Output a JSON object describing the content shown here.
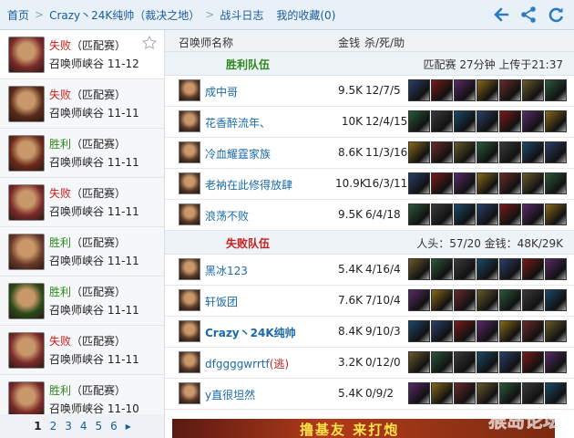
{
  "breadcrumb": [
    "首页",
    "Crazy丶24K纯帅（裁决之地）",
    "战斗日志"
  ],
  "favorites_label": "我的收藏(0)",
  "colors": {
    "win": "#2a8a1a",
    "loss": "#c81e1e",
    "link": "#1a5a9a"
  },
  "top_icons": [
    "back-arrow-icon",
    "share-icon",
    "refresh-icon"
  ],
  "matches": [
    {
      "result": "失败",
      "type": "（匹配赛）",
      "map": "召唤师峡谷",
      "date": "11-12",
      "win": false
    },
    {
      "result": "失败",
      "type": "（匹配赛）",
      "map": "召唤师峡谷",
      "date": "11-11",
      "win": false
    },
    {
      "result": "胜利",
      "type": "（匹配赛）",
      "map": "召唤师峡谷",
      "date": "11-11",
      "win": true
    },
    {
      "result": "失败",
      "type": "（匹配赛）",
      "map": "召唤师峡谷",
      "date": "11-11",
      "win": false
    },
    {
      "result": "胜利",
      "type": "（匹配赛）",
      "map": "召唤师峡谷",
      "date": "11-11",
      "win": true
    },
    {
      "result": "胜利",
      "type": "（匹配赛）",
      "map": "召唤师峡谷",
      "date": "11-11",
      "win": true
    },
    {
      "result": "失败",
      "type": "（匹配赛）",
      "map": "召唤师峡谷",
      "date": "11-11",
      "win": false
    },
    {
      "result": "胜利",
      "type": "（匹配赛）",
      "map": "召唤师峡谷",
      "date": "11-10",
      "win": true
    }
  ],
  "pager": [
    "1",
    "2",
    "3",
    "4",
    "5",
    "6",
    "▸"
  ],
  "table_header": {
    "name": "召唤师名称",
    "gold": "金钱",
    "kda": "杀/死/助"
  },
  "win_team": {
    "label": "胜利队伍",
    "info": "匹配赛 27分钟 上传于21:37",
    "players": [
      {
        "name": "成中哥",
        "gold": "9.5K",
        "kda": "12/7/5",
        "bold": false
      },
      {
        "name": "花香醉流年、",
        "gold": "10K",
        "kda": "12/4/15",
        "bold": false
      },
      {
        "name": "冷血耀霆家族",
        "gold": "8.6K",
        "kda": "11/3/16",
        "bold": false
      },
      {
        "name": "老衲在此修得放肆",
        "gold": "10.9K",
        "kda": "16/3/11",
        "bold": false
      },
      {
        "name": "浪荡不败",
        "gold": "9.5K",
        "kda": "6/4/18",
        "bold": false
      }
    ]
  },
  "lose_team": {
    "label": "失败队伍",
    "info": "人头：57/20 金钱：48K/29K",
    "players": [
      {
        "name": "黑冰123",
        "gold": "5.4K",
        "kda": "4/16/4",
        "bold": false
      },
      {
        "name": "轩饭团",
        "gold": "7.6K",
        "kda": "7/10/4",
        "bold": false
      },
      {
        "name": "Crazy丶24K纯帅",
        "gold": "8.4K",
        "kda": "9/10/3",
        "bold": true
      },
      {
        "name": "dfggggwrrtf",
        "flag": "(逃)",
        "gold": "3.2K",
        "kda": "0/12/0",
        "bold": false
      },
      {
        "name": "y直很坦然",
        "gold": "5.4K",
        "kda": "0/9/2",
        "bold": false
      }
    ]
  },
  "banner_text": "撸基友  来打炮",
  "watermark": "猴岛论坛"
}
